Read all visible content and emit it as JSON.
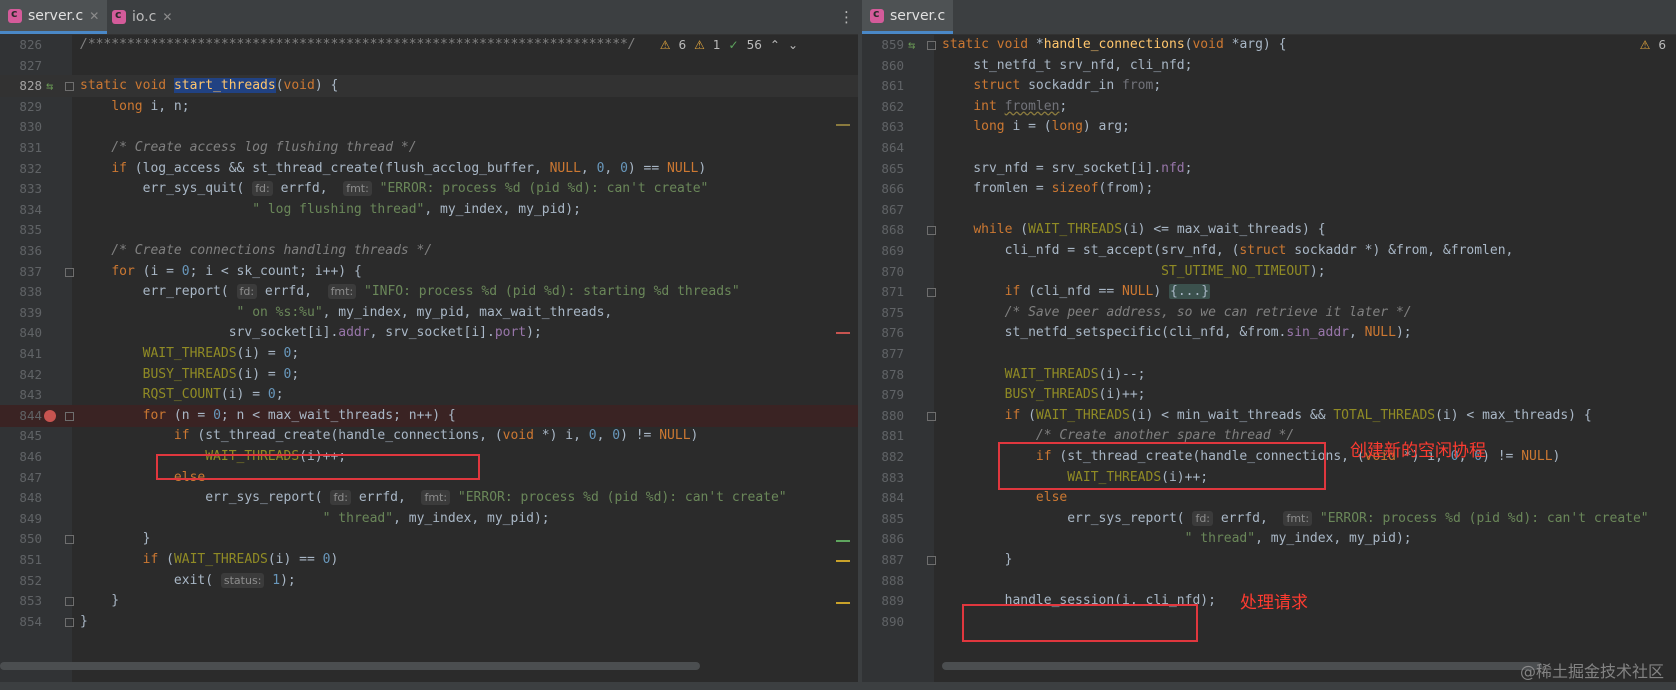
{
  "left": {
    "tabs": [
      {
        "label": "server.c",
        "active": true
      },
      {
        "label": "io.c",
        "active": false
      }
    ],
    "inspections": {
      "warnings": "6",
      "weak": "1",
      "ok": "56"
    },
    "lines": [
      {
        "n": "826",
        "code": "/*********************************************************************/"
      },
      {
        "n": "827",
        "code": ""
      },
      {
        "n": "828",
        "code": "static void start_threads(void) {"
      },
      {
        "n": "829",
        "code": "    long i, n;"
      },
      {
        "n": "830",
        "code": ""
      },
      {
        "n": "831",
        "code": "    /* Create access log flushing thread */"
      },
      {
        "n": "832",
        "code": "    if (log_access && st_thread_create(flush_acclog_buffer, NULL, 0, 0) == NULL)"
      },
      {
        "n": "833",
        "code": "        err_sys_quit( fd: errfd,  fmt: \"ERROR: process %d (pid %d): can't create\""
      },
      {
        "n": "834",
        "code": "                      \" log flushing thread\", my_index, my_pid);"
      },
      {
        "n": "835",
        "code": ""
      },
      {
        "n": "836",
        "code": "    /* Create connections handling threads */"
      },
      {
        "n": "837",
        "code": "    for (i = 0; i < sk_count; i++) {"
      },
      {
        "n": "838",
        "code": "        err_report( fd: errfd,  fmt: \"INFO: process %d (pid %d): starting %d threads\""
      },
      {
        "n": "839",
        "code": "                    \" on %s:%u\", my_index, my_pid, max_wait_threads,"
      },
      {
        "n": "840",
        "code": "                   srv_socket[i].addr, srv_socket[i].port);"
      },
      {
        "n": "841",
        "code": "        WAIT_THREADS(i) = 0;"
      },
      {
        "n": "842",
        "code": "        BUSY_THREADS(i) = 0;"
      },
      {
        "n": "843",
        "code": "        RQST_COUNT(i) = 0;"
      },
      {
        "n": "844",
        "code": "        for (n = 0; n < max_wait_threads; n++) {"
      },
      {
        "n": "845",
        "code": "            if (st_thread_create(handle_connections, (void *) i, 0, 0) != NULL)"
      },
      {
        "n": "846",
        "code": "                WAIT_THREADS(i)++;"
      },
      {
        "n": "847",
        "code": "            else"
      },
      {
        "n": "848",
        "code": "                err_sys_report( fd: errfd,  fmt: \"ERROR: process %d (pid %d): can't create\""
      },
      {
        "n": "849",
        "code": "                               \" thread\", my_index, my_pid);"
      },
      {
        "n": "850",
        "code": "        }"
      },
      {
        "n": "851",
        "code": "        if (WAIT_THREADS(i) == 0)"
      },
      {
        "n": "852",
        "code": "            exit( status: 1);"
      },
      {
        "n": "853",
        "code": "    }"
      },
      {
        "n": "854",
        "code": "}"
      }
    ]
  },
  "right": {
    "tabs": [
      {
        "label": "server.c",
        "active": true
      }
    ],
    "inspections": {
      "warnings": "6"
    },
    "lines": [
      {
        "n": "859",
        "code": "static void *handle_connections(void *arg) {"
      },
      {
        "n": "860",
        "code": "    st_netfd_t srv_nfd, cli_nfd;"
      },
      {
        "n": "861",
        "code": "    struct sockaddr_in from;"
      },
      {
        "n": "862",
        "code": "    int fromlen;"
      },
      {
        "n": "863",
        "code": "    long i = (long) arg;"
      },
      {
        "n": "864",
        "code": ""
      },
      {
        "n": "865",
        "code": "    srv_nfd = srv_socket[i].nfd;"
      },
      {
        "n": "866",
        "code": "    fromlen = sizeof(from);"
      },
      {
        "n": "867",
        "code": ""
      },
      {
        "n": "868",
        "code": "    while (WAIT_THREADS(i) <= max_wait_threads) {"
      },
      {
        "n": "869",
        "code": "        cli_nfd = st_accept(srv_nfd, (struct sockaddr *) &from, &fromlen,"
      },
      {
        "n": "870",
        "code": "                            ST_UTIME_NO_TIMEOUT);"
      },
      {
        "n": "871",
        "code": "        if (cli_nfd == NULL) {...}"
      },
      {
        "n": "875",
        "code": "        /* Save peer address, so we can retrieve it later */"
      },
      {
        "n": "876",
        "code": "        st_netfd_setspecific(cli_nfd, &from.sin_addr, NULL);"
      },
      {
        "n": "877",
        "code": ""
      },
      {
        "n": "878",
        "code": "        WAIT_THREADS(i)--;"
      },
      {
        "n": "879",
        "code": "        BUSY_THREADS(i)++;"
      },
      {
        "n": "880",
        "code": "        if (WAIT_THREADS(i) < min_wait_threads && TOTAL_THREADS(i) < max_threads) {"
      },
      {
        "n": "881",
        "code": "            /* Create another spare thread */"
      },
      {
        "n": "882",
        "code": "            if (st_thread_create(handle_connections, (void *) i, 0, 0) != NULL)"
      },
      {
        "n": "883",
        "code": "                WAIT_THREADS(i)++;"
      },
      {
        "n": "884",
        "code": "            else"
      },
      {
        "n": "885",
        "code": "                err_sys_report( fd: errfd,  fmt: \"ERROR: process %d (pid %d): can't create\""
      },
      {
        "n": "886",
        "code": "                               \" thread\", my_index, my_pid);"
      },
      {
        "n": "887",
        "code": "        }"
      },
      {
        "n": "888",
        "code": ""
      },
      {
        "n": "889",
        "code": "        handle_session(i, cli_nfd);"
      },
      {
        "n": "890",
        "code": ""
      }
    ]
  },
  "annotations": {
    "create_coroutine": "创建新的空闲协程",
    "handle_request": "处理请求"
  },
  "watermark": "@稀土掘金技术社区",
  "colors": {
    "keyword": "#cc7832",
    "function": "#ffc66d",
    "number": "#6897bb",
    "string": "#6a8759",
    "comment": "#808080",
    "annotation_red": "#ff3b30"
  }
}
